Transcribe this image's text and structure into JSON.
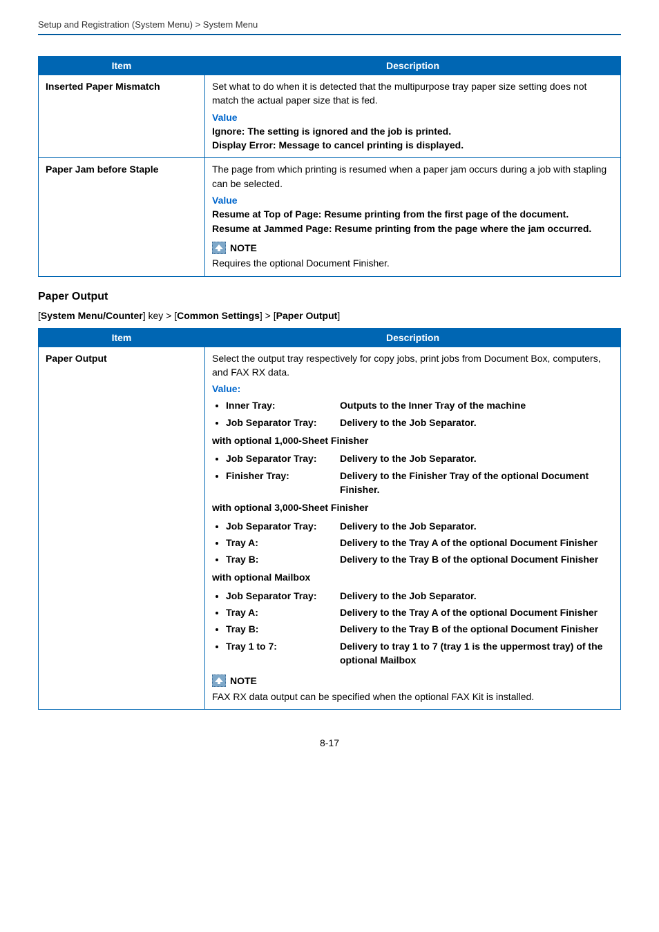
{
  "breadcrumb": "Setup and Registration (System Menu) > System Menu",
  "table1": {
    "headers": {
      "item": "Item",
      "desc": "Description"
    },
    "rows": [
      {
        "item": "Inserted Paper Mismatch",
        "desc_intro": "Set what to do when it is detected that the multipurpose tray paper size setting does not match the actual paper size that is fed.",
        "value_label": "Value",
        "line1": "Ignore: The setting is ignored and the job is printed.",
        "line2": "Display Error: Message to cancel printing is displayed."
      },
      {
        "item": "Paper Jam before Staple",
        "desc_intro": "The page from which printing is resumed when a paper jam occurs during a job with stapling can be selected.",
        "value_label": "Value",
        "line1": "Resume at Top of Page: Resume printing from the first page of the document.",
        "line2": "Resume at Jammed Page: Resume printing from the page where the jam occurred.",
        "note_label": "NOTE",
        "note_text": "Requires the optional Document Finisher."
      }
    ]
  },
  "section_heading": "Paper Output",
  "menu_path": {
    "p1": "System Menu/Counter",
    "mid1": "] key > [",
    "p2": "Common Settings",
    "mid2": "] > [",
    "p3": "Paper Output",
    "end": "]"
  },
  "table2": {
    "headers": {
      "item": "Item",
      "desc": "Description"
    },
    "row": {
      "item": "Paper Output",
      "intro": "Select the output tray respectively for copy jobs, print jobs from Document Box, computers, and FAX RX data.",
      "value_label": "Value:",
      "group_default": [
        {
          "label": "Inner Tray:",
          "desc": "Outputs to the Inner Tray of the machine"
        },
        {
          "label": "Job Separator Tray:",
          "desc": "Delivery to the Job Separator."
        }
      ],
      "head_1000": "with optional 1,000-Sheet Finisher",
      "group_1000": [
        {
          "label": "Job Separator Tray:",
          "desc": "Delivery to the Job Separator."
        },
        {
          "label": "Finisher Tray:",
          "desc": "Delivery to the Finisher Tray of the optional Document Finisher."
        }
      ],
      "head_3000": "with optional 3,000-Sheet Finisher",
      "group_3000": [
        {
          "label": "Job Separator Tray:",
          "desc": "Delivery to the Job Separator."
        },
        {
          "label": "Tray A:",
          "desc": "Delivery to the Tray A of the optional Document Finisher"
        },
        {
          "label": "Tray B:",
          "desc": "Delivery to the Tray B of the optional Document Finisher"
        }
      ],
      "head_mailbox": "with optional Mailbox",
      "group_mailbox": [
        {
          "label": "Job Separator Tray:",
          "desc": "Delivery to the Job Separator."
        },
        {
          "label": "Tray A:",
          "desc": "Delivery to the Tray A of the optional Document Finisher"
        },
        {
          "label": "Tray B:",
          "desc": "Delivery to the Tray B of the optional Document Finisher"
        },
        {
          "label": "Tray 1 to 7:",
          "desc": "Delivery to tray 1 to 7 (tray 1 is the uppermost tray) of the optional Mailbox"
        }
      ],
      "note_label": "NOTE",
      "note_text": "FAX RX data output can be specified when the optional FAX Kit is installed."
    }
  },
  "page_number": "8-17"
}
